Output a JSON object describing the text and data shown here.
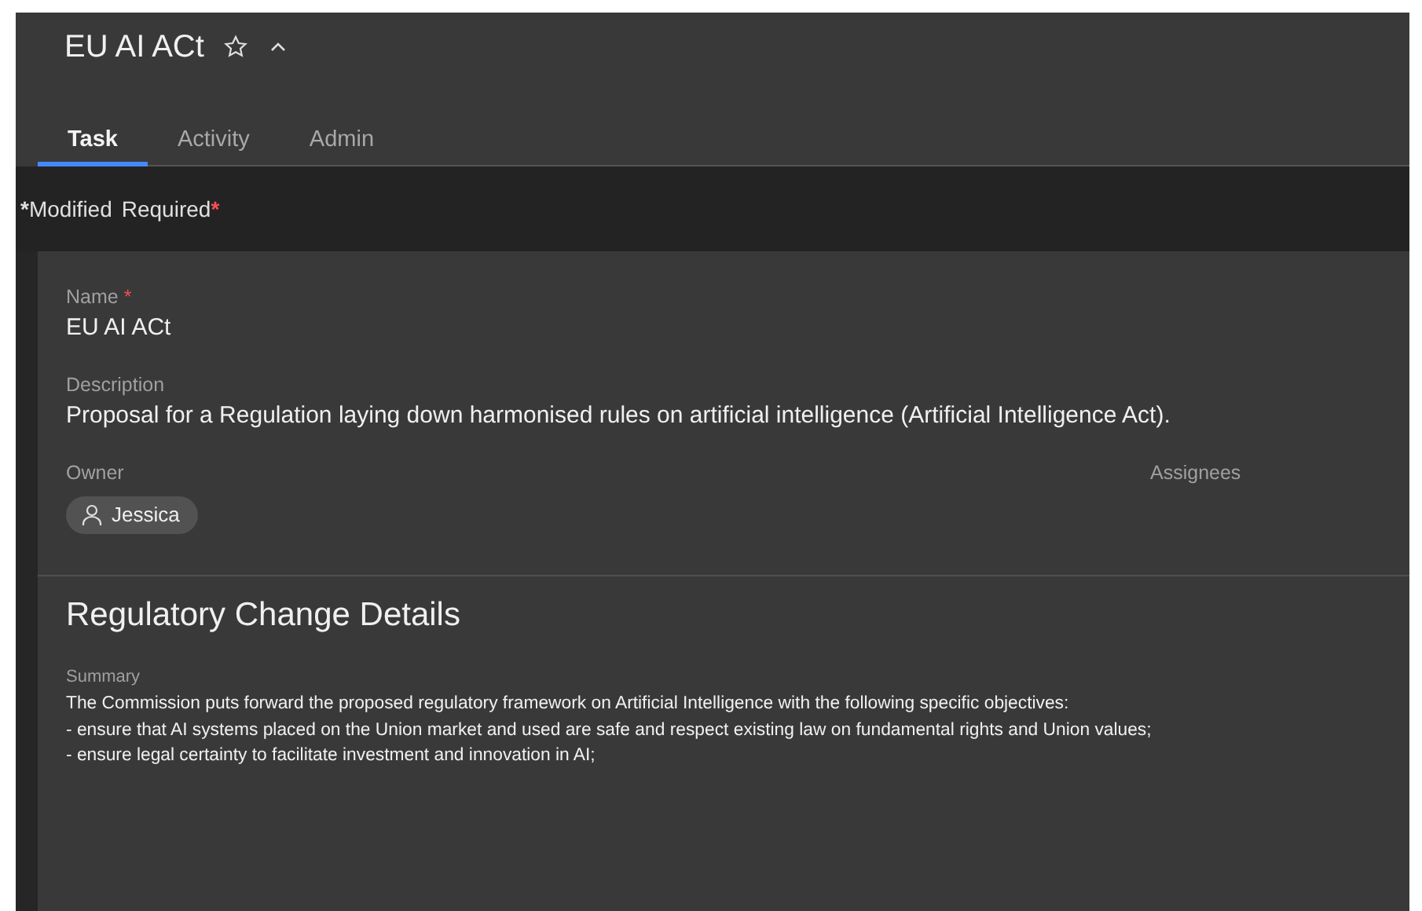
{
  "header": {
    "title": "EU AI ACt",
    "starred": false,
    "expanded": true
  },
  "tabs": [
    {
      "label": "Task",
      "selected": true
    },
    {
      "label": "Activity",
      "selected": false
    },
    {
      "label": "Admin",
      "selected": false
    }
  ],
  "legend": [
    {
      "kind": "modified",
      "mark": "*",
      "label": "Modified"
    },
    {
      "kind": "required",
      "mark": "*",
      "label": "Required"
    }
  ],
  "fields": [
    {
      "label": "Name",
      "required_mark": "*",
      "value": "EU AI ACt"
    },
    {
      "label": "Description",
      "value": "Proposal for a Regulation laying down harmonised rules on artificial intelligence (Artificial Intelligence Act)."
    }
  ],
  "owner": {
    "label": "Owner",
    "name": "Jessica"
  },
  "assignees": {
    "label": "Assignees"
  },
  "section": {
    "title": "Regulatory Change Details",
    "summary_label": "Summary",
    "summary_lines": [
      "The Commission puts forward the proposed regulatory framework on Artificial Intelligence with the following specific objectives:",
      "- ensure that AI systems placed on the Union market and used are safe and respect existing law on fundamental rights and Union values;",
      "- ensure legal certainty to facilitate investment and innovation in AI;"
    ]
  }
}
